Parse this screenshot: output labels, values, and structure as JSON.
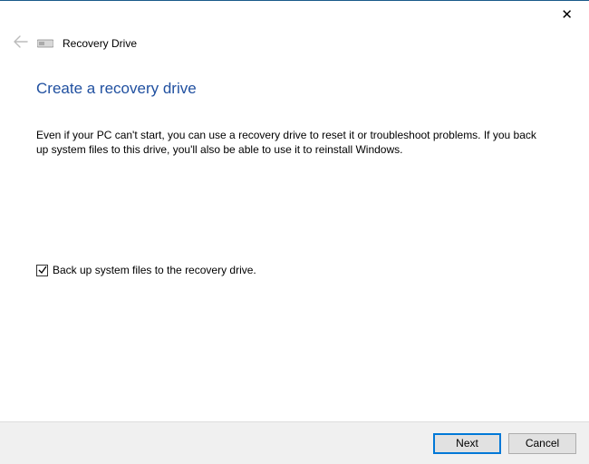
{
  "header": {
    "title": "Recovery Drive"
  },
  "main": {
    "title": "Create a recovery drive",
    "description": "Even if your PC can't start, you can use a recovery drive to reset it or troubleshoot problems. If you back up system files to this drive, you'll also be able to use it to reinstall Windows."
  },
  "checkbox": {
    "label": "Back up system files to the recovery drive.",
    "checked": true
  },
  "footer": {
    "next_label": "Next",
    "cancel_label": "Cancel"
  }
}
